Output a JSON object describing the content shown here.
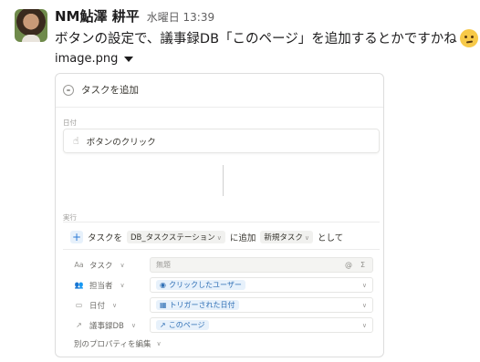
{
  "message": {
    "username": "NM鮎澤 耕平",
    "timestamp": "水曜日 13:39",
    "text": "ボタンの設定で、議事録DB「このページ」を追加するとかですかね",
    "emoji": "thinking-face"
  },
  "attachment": {
    "filename": "image.png"
  },
  "card": {
    "add_task_label": "タスクを追加",
    "trigger_section": "日付",
    "trigger_label": "ボタンのクリック",
    "action_section": "実行",
    "action": {
      "prefix": "タスクを",
      "db": "DB_タスクステーション",
      "mid": "に追加",
      "type": "新規タスク",
      "suffix": "として"
    },
    "properties": [
      {
        "icon": "Aa",
        "name": "タスク",
        "value": "無題",
        "extra_icons": [
          "@",
          "Σ"
        ]
      },
      {
        "icon": "person-icon",
        "name": "担当者",
        "value": "クリックしたユーザー"
      },
      {
        "icon": "calendar-icon",
        "name": "日付",
        "value": "トリガーされた日付"
      },
      {
        "icon": "arrow-icon",
        "name": "議事録DB",
        "value": "このページ"
      }
    ],
    "edit_label": "別のプロパティを編集"
  }
}
